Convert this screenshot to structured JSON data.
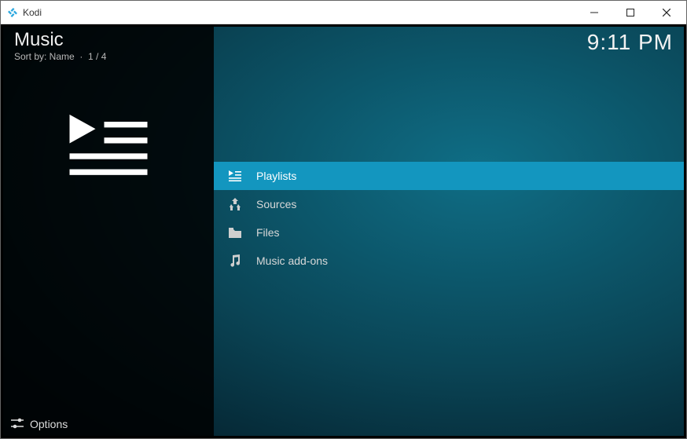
{
  "window": {
    "app_title": "Kodi"
  },
  "header": {
    "section": "Music",
    "sort_label": "Sort by: Name",
    "position": "1 / 4",
    "clock": "9:11 PM"
  },
  "list": {
    "items": [
      {
        "icon": "playlist-icon",
        "label": "Playlists",
        "selected": true
      },
      {
        "icon": "sources-icon",
        "label": "Sources",
        "selected": false
      },
      {
        "icon": "folder-icon",
        "label": "Files",
        "selected": false
      },
      {
        "icon": "music-note-icon",
        "label": "Music add-ons",
        "selected": false
      }
    ]
  },
  "footer": {
    "options_label": "Options"
  }
}
